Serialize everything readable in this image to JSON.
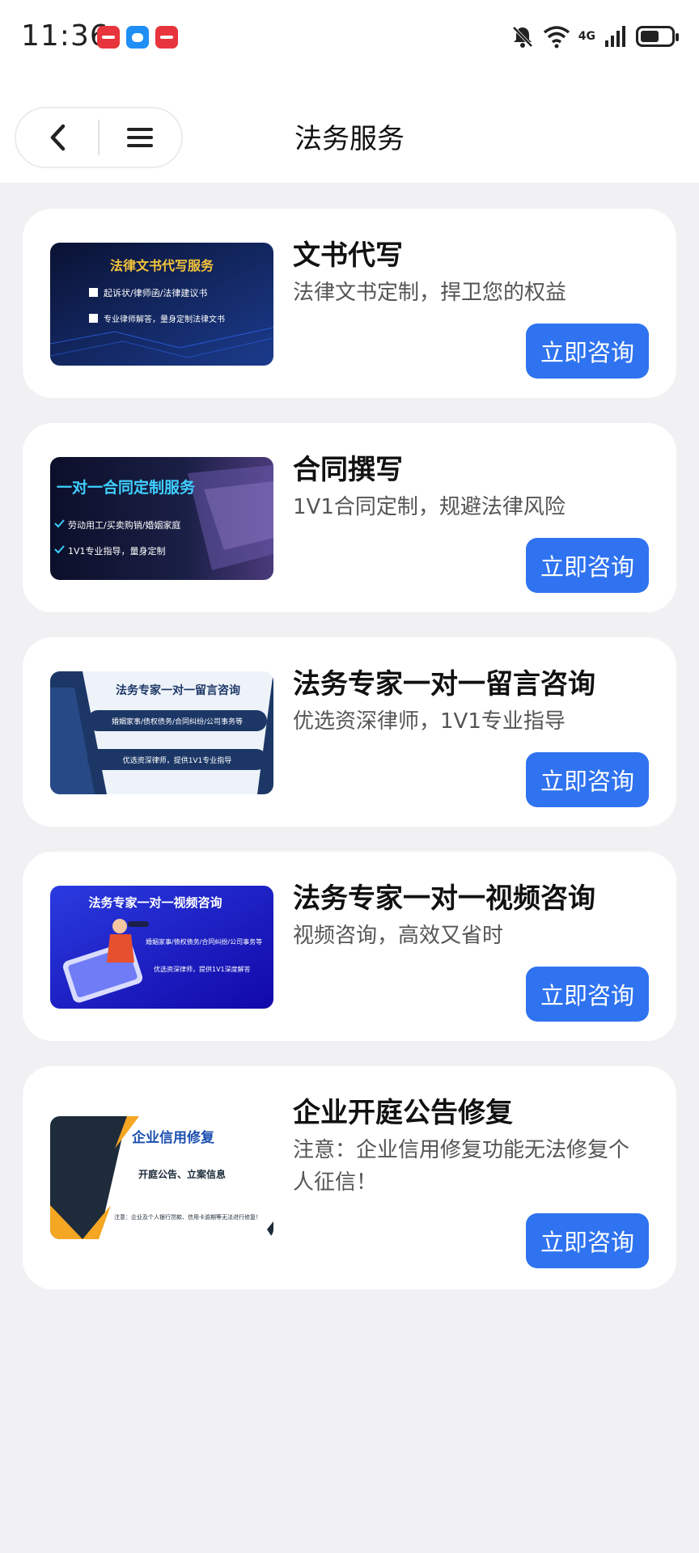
{
  "status_bar": {
    "time": "11:36",
    "network_label": "4G",
    "battery_level": 0.6,
    "icons": [
      "bell-muted-icon",
      "wifi-icon",
      "signal-icon",
      "battery-icon"
    ]
  },
  "header": {
    "title": "法务服务",
    "back_icon": "chevron-left-icon",
    "menu_icon": "hamburger-menu-icon"
  },
  "colors": {
    "accent": "#2f73f0",
    "background": "#f1f1f3",
    "card": "#ffffff"
  },
  "services": [
    {
      "title": "文书代写",
      "desc": "法律文书定制，捍卫您的权益",
      "cta": "立即咨询",
      "thumb": {
        "heading": "法律文书代写服务",
        "line1": "起诉状/律师函/法律建议书",
        "line2": "专业律师解答，量身定制法律文书"
      }
    },
    {
      "title": "合同撰写",
      "desc": "1V1合同定制，规避法律风险",
      "cta": "立即咨询",
      "thumb": {
        "heading": "一对一合同定制服务",
        "line1": "劳动用工/买卖购销/婚姻家庭",
        "line2": "1V1专业指导，量身定制"
      }
    },
    {
      "title": "法务专家一对一留言咨询",
      "desc": "优选资深律师，1V1专业指导",
      "cta": "立即咨询",
      "thumb": {
        "heading": "法务专家一对一留言咨询",
        "line1": "婚姻家事/债权债务/合同纠纷/公司事务等",
        "line2": "优选资深律师，提供1V1专业指导"
      }
    },
    {
      "title": "法务专家一对一视频咨询",
      "desc": "视频咨询，高效又省时",
      "cta": "立即咨询",
      "thumb": {
        "heading": "法务专家一对一视频咨询",
        "line1": "婚姻家事/债权债务/合同纠纷/公司事务等",
        "line2": "优选资深律师，提供1V1深度解答"
      }
    },
    {
      "title": "企业开庭公告修复",
      "desc": "注意：企业信用修复功能无法修复个人征信！",
      "cta": "立即咨询",
      "thumb": {
        "heading": "企业信用修复",
        "line1": "开庭公告、立案信息",
        "line2": "注意：企业及个人银行贷款、信用卡逾期等无法进行修复！"
      }
    }
  ]
}
